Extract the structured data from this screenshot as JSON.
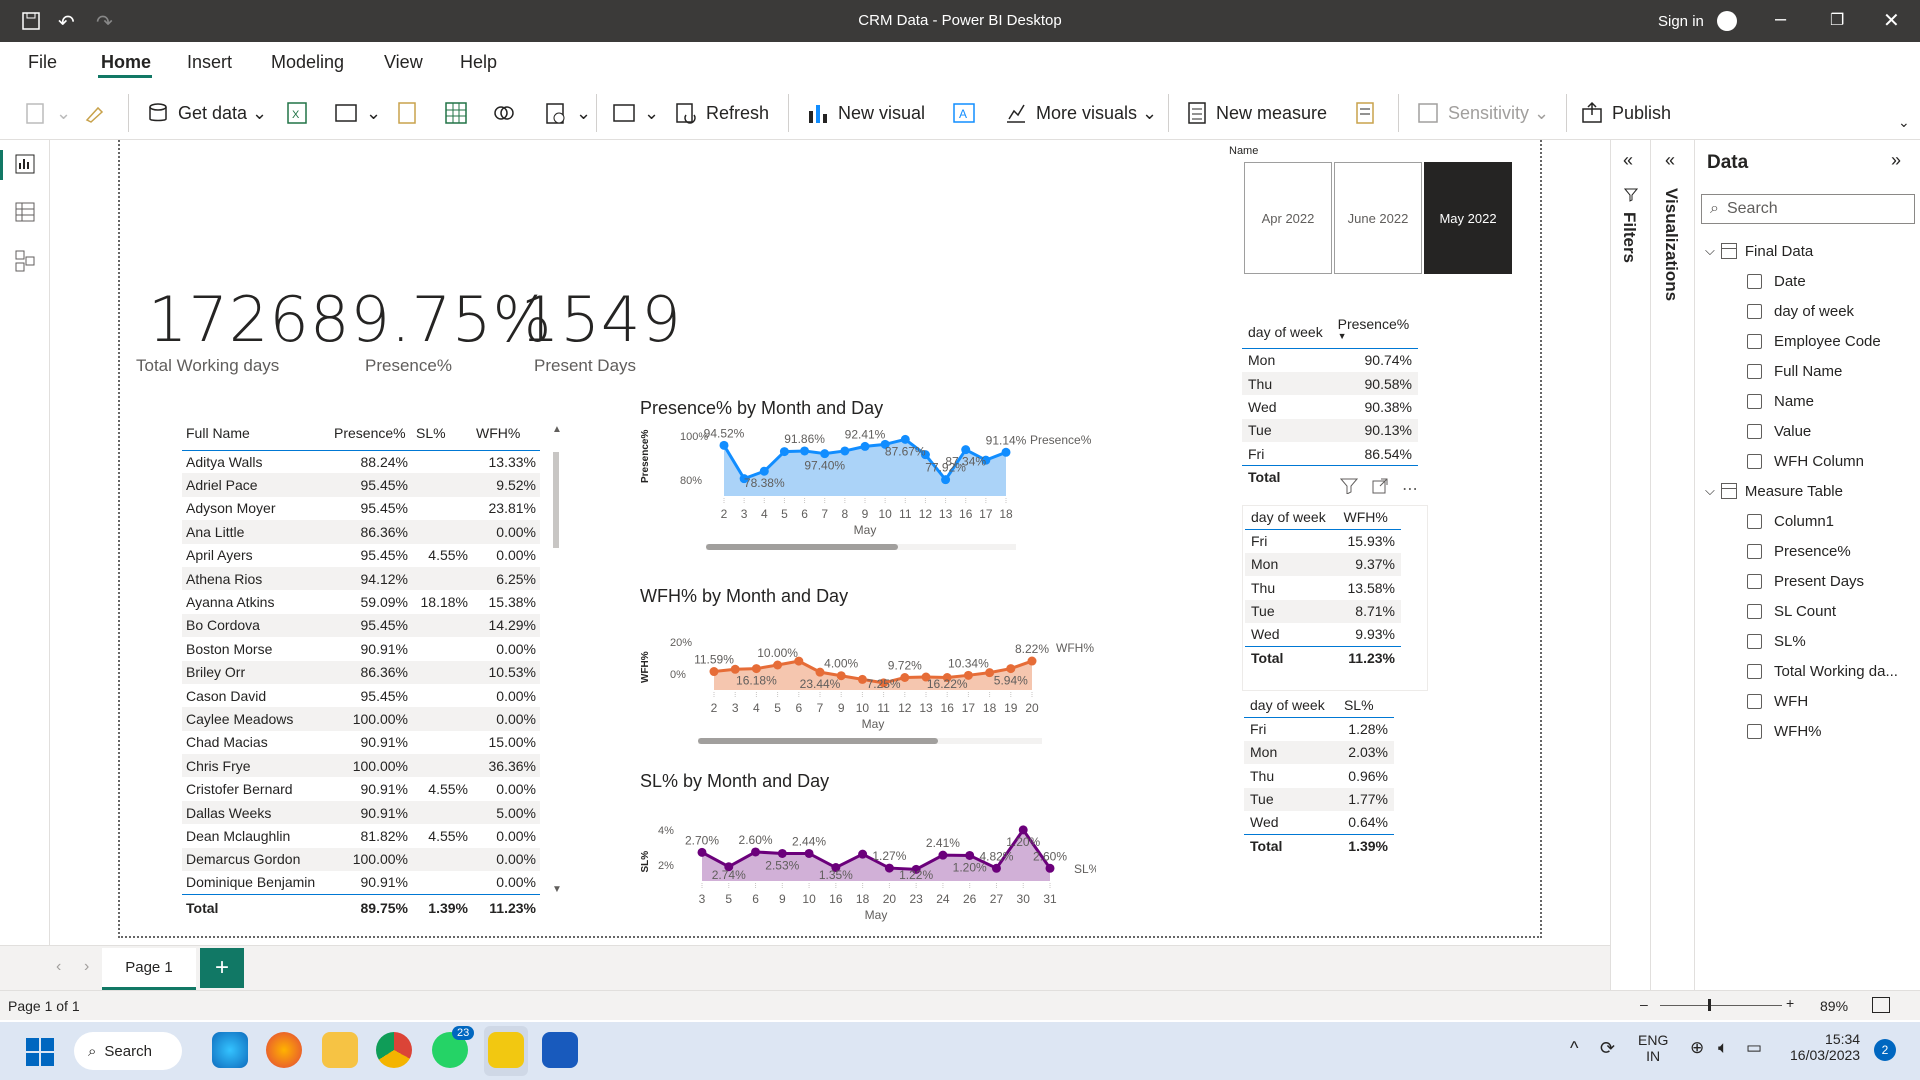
{
  "window": {
    "title": "CRM Data - Power BI Desktop",
    "sign_in": "Sign in"
  },
  "menu": [
    "File",
    "Home",
    "Insert",
    "Modeling",
    "View",
    "Help"
  ],
  "ribbon": {
    "get_data": "Get data",
    "refresh": "Refresh",
    "new_visual": "New visual",
    "more_visuals": "More visuals",
    "new_measure": "New measure",
    "sensitivity": "Sensitivity",
    "publish": "Publish"
  },
  "slicer": {
    "label": "Name",
    "items": [
      "Apr 2022",
      "June 2022",
      "May 2022"
    ],
    "selected": "May 2022"
  },
  "kpis": [
    {
      "value": "1726",
      "label": "Total Working days"
    },
    {
      "value": "89.75%",
      "label": "Presence%"
    },
    {
      "value": "1549",
      "label": "Present Days"
    }
  ],
  "employee_table": {
    "columns": [
      "Full Name",
      "Presence%",
      "SL%",
      "WFH%"
    ],
    "rows": [
      [
        "Aditya Walls",
        "88.24%",
        "",
        "13.33%"
      ],
      [
        "Adriel Pace",
        "95.45%",
        "",
        "9.52%"
      ],
      [
        "Adyson Moyer",
        "95.45%",
        "",
        "23.81%"
      ],
      [
        "Ana Little",
        "86.36%",
        "",
        "0.00%"
      ],
      [
        "April Ayers",
        "95.45%",
        "4.55%",
        "0.00%"
      ],
      [
        "Athena Rios",
        "94.12%",
        "",
        "6.25%"
      ],
      [
        "Ayanna Atkins",
        "59.09%",
        "18.18%",
        "15.38%"
      ],
      [
        "Bo Cordova",
        "95.45%",
        "",
        "14.29%"
      ],
      [
        "Boston Morse",
        "90.91%",
        "",
        "0.00%"
      ],
      [
        "Briley Orr",
        "86.36%",
        "",
        "10.53%"
      ],
      [
        "Cason David",
        "95.45%",
        "",
        "0.00%"
      ],
      [
        "Caylee Meadows",
        "100.00%",
        "",
        "0.00%"
      ],
      [
        "Chad Macias",
        "90.91%",
        "",
        "15.00%"
      ],
      [
        "Chris Frye",
        "100.00%",
        "",
        "36.36%"
      ],
      [
        "Cristofer Bernard",
        "90.91%",
        "4.55%",
        "0.00%"
      ],
      [
        "Dallas Weeks",
        "90.91%",
        "",
        "5.00%"
      ],
      [
        "Dean Mclaughlin",
        "81.82%",
        "4.55%",
        "0.00%"
      ],
      [
        "Demarcus Gordon",
        "100.00%",
        "",
        "0.00%"
      ],
      [
        "Dominique Benjamin",
        "90.91%",
        "",
        "0.00%"
      ]
    ],
    "total": [
      "Total",
      "89.75%",
      "1.39%",
      "11.23%"
    ]
  },
  "presence_by_dow": {
    "columns": [
      "day of week",
      "Presence%"
    ],
    "rows": [
      [
        "Mon",
        "90.74%"
      ],
      [
        "Thu",
        "90.58%"
      ],
      [
        "Wed",
        "90.38%"
      ],
      [
        "Tue",
        "90.13%"
      ],
      [
        "Fri",
        "86.54%"
      ]
    ],
    "total": [
      "Total",
      ""
    ]
  },
  "wfh_by_dow": {
    "columns": [
      "day of week",
      "WFH%"
    ],
    "rows": [
      [
        "Fri",
        "15.93%"
      ],
      [
        "Mon",
        "9.37%"
      ],
      [
        "Thu",
        "13.58%"
      ],
      [
        "Tue",
        "8.71%"
      ],
      [
        "Wed",
        "9.93%"
      ]
    ],
    "total": [
      "Total",
      "11.23%"
    ]
  },
  "sl_by_dow": {
    "columns": [
      "day of week",
      "SL%"
    ],
    "rows": [
      [
        "Fri",
        "1.28%"
      ],
      [
        "Mon",
        "2.03%"
      ],
      [
        "Thu",
        "0.96%"
      ],
      [
        "Tue",
        "1.77%"
      ],
      [
        "Wed",
        "0.64%"
      ]
    ],
    "total": [
      "Total",
      "1.39%"
    ]
  },
  "chart_data": [
    {
      "type": "area",
      "title": "Presence% by Month and Day",
      "xlabel": "May",
      "ylabel": "Presence%",
      "legend": "Presence%",
      "color": "#118dff",
      "fill": "#9ccbf7",
      "categories": [
        "2",
        "3",
        "4",
        "5",
        "6",
        "7",
        "8",
        "9",
        "10",
        "11",
        "12",
        "13",
        "16",
        "17",
        "18"
      ],
      "values": [
        94.52,
        78.38,
        82,
        91.5,
        91.8,
        90.5,
        91.8,
        94,
        95,
        97.4,
        90,
        77.92,
        92.41,
        87.34,
        91.14
      ],
      "ylim": [
        70,
        100
      ],
      "yticks": [
        "100%",
        "80%"
      ],
      "labels": [
        "94.52%",
        "78.38%",
        "91.86%",
        "97.40%",
        "92.41%",
        "87.67%",
        "77.92%",
        "87.34%",
        "91.14%"
      ]
    },
    {
      "type": "area",
      "title": "WFH% by Month and Day",
      "xlabel": "May",
      "ylabel": "WFH%",
      "legend": "WFH%",
      "color": "#e66c37",
      "fill": "#f3bca1",
      "categories": [
        "2",
        "3",
        "4",
        "5",
        "6",
        "7",
        "9",
        "10",
        "11",
        "12",
        "13",
        "16",
        "17",
        "18",
        "19",
        "20"
      ],
      "values": [
        10.34,
        11.59,
        12,
        14,
        16.18,
        10,
        8,
        5.94,
        4,
        7,
        7.25,
        7,
        8.22,
        9.72,
        12,
        16.22
      ],
      "ylim": [
        0,
        28
      ],
      "yticks": [
        "20%",
        "0%"
      ],
      "labels": [
        "11.59%",
        "16.18%",
        "10.00%",
        "23.44%",
        "4.00%",
        "7.25%",
        "9.72%",
        "16.22%",
        "10.34%",
        "5.94%",
        "8.22%"
      ]
    },
    {
      "type": "area",
      "title": "SL% by Month and Day",
      "xlabel": "May",
      "ylabel": "SL%",
      "legend": "SL%",
      "color": "#6b007b",
      "fill": "#c9a2d0",
      "categories": [
        "3",
        "5",
        "6",
        "9",
        "10",
        "16",
        "18",
        "20",
        "23",
        "24",
        "26",
        "27",
        "30",
        "31"
      ],
      "values": [
        2.7,
        1.35,
        2.74,
        2.6,
        2.6,
        1.27,
        2.53,
        1.22,
        1.1,
        2.44,
        2.41,
        1.2,
        4.82,
        1.2
      ],
      "ylim": [
        0,
        5
      ],
      "yticks": [
        "4%",
        "2%"
      ],
      "labels": [
        "2.70%",
        "2.74%",
        "2.60%",
        "2.53%",
        "2.44%",
        "1.35%",
        "1.27%",
        "1.22%",
        "2.41%",
        "1.20%",
        "4.82%",
        "1.20%",
        "2.60%"
      ]
    }
  ],
  "data_pane": {
    "title": "Data",
    "search_placeholder": "Search",
    "tables": [
      {
        "name": "Final Data",
        "fields": [
          "Date",
          "day of week",
          "Employee Code",
          "Full Name",
          "Name",
          "Value",
          "WFH Column"
        ]
      },
      {
        "name": "Measure Table",
        "fields": [
          "Column1",
          "Presence%",
          "Present Days",
          "SL Count",
          "SL%",
          "Total Working da...",
          "WFH",
          "WFH%"
        ]
      }
    ]
  },
  "panes": {
    "filters": "Filters",
    "visualizations": "Visualizations"
  },
  "pages": {
    "tab": "Page 1",
    "status": "Page 1 of 1",
    "zoom": "89%"
  },
  "taskbar": {
    "search": "Search",
    "badge_whatsapp": "23",
    "lang": "ENG",
    "region": "IN",
    "time": "15:34",
    "date": "16/03/2023",
    "notif": "2"
  }
}
